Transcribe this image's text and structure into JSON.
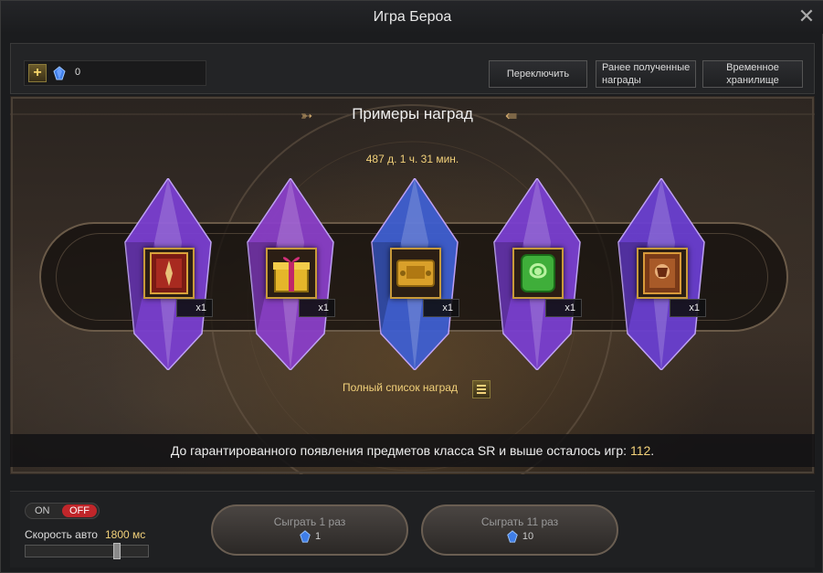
{
  "window": {
    "title": "Игра Бероа"
  },
  "topbar": {
    "currency_value": "0",
    "switch_label": "Переключить",
    "prev_rewards_label": "Ранее полученные награды",
    "temp_storage_label": "Временное хранилище"
  },
  "rewards": {
    "title": "Примеры наград",
    "timer": "487 д. 1 ч. 31 мин.",
    "items": [
      {
        "icon": "red-tome-icon",
        "qty": "x1",
        "crystal_color": "#7a3fd0"
      },
      {
        "icon": "gift-box-icon",
        "qty": "x1",
        "crystal_color": "#8a3fc8"
      },
      {
        "icon": "gold-ticket-icon",
        "qty": "x1",
        "crystal_color": "#3f5fd0"
      },
      {
        "icon": "green-scroll-icon",
        "qty": "x1",
        "crystal_color": "#7a3fd0"
      },
      {
        "icon": "bronze-tome-icon",
        "qty": "x1",
        "crystal_color": "#6a3fd0"
      }
    ],
    "full_list_label": "Полный список наград",
    "guarantee_text": "До гарантированного появления предметов класса SR и выше осталось игр:",
    "guarantee_count": "112",
    "guarantee_suffix": "."
  },
  "bottom": {
    "toggle_on": "ON",
    "toggle_off": "OFF",
    "toggle_state": "off",
    "speed_label": "Скорость авто",
    "speed_value": "1800 мс",
    "speed_slider_fraction": 0.75,
    "play1_label": "Сыграть 1 раз",
    "play1_cost": "1",
    "play11_label": "Сыграть 11 раз",
    "play11_cost": "10"
  },
  "colors": {
    "accent_gold": "#f2d17a",
    "off_red": "#c0262a"
  }
}
